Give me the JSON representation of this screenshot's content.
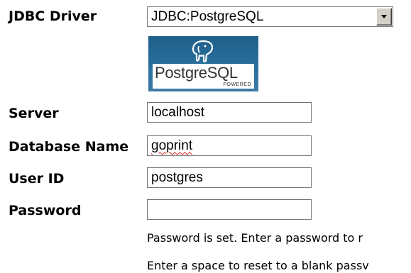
{
  "form": {
    "driver": {
      "label": "JDBC Driver",
      "selected": "JDBC:PostgreSQL"
    },
    "logo": {
      "text": "PostgreSQL",
      "subtext": "POWERED",
      "icon": "postgres-elephant-icon"
    },
    "server": {
      "label": "Server",
      "value": "localhost"
    },
    "database": {
      "label": "Database Name",
      "value": "goprint"
    },
    "user": {
      "label": "User ID",
      "value": "postgres"
    },
    "password": {
      "label": "Password",
      "value": ""
    },
    "notes": {
      "line1": "Password is set. Enter a password to r",
      "line2": "Enter a space to reset to a blank passv"
    }
  },
  "colors": {
    "logo_background": "#2a6f9c",
    "spellcheck_underline": "#e02020",
    "dropdown_button": "#d4d0c8"
  }
}
